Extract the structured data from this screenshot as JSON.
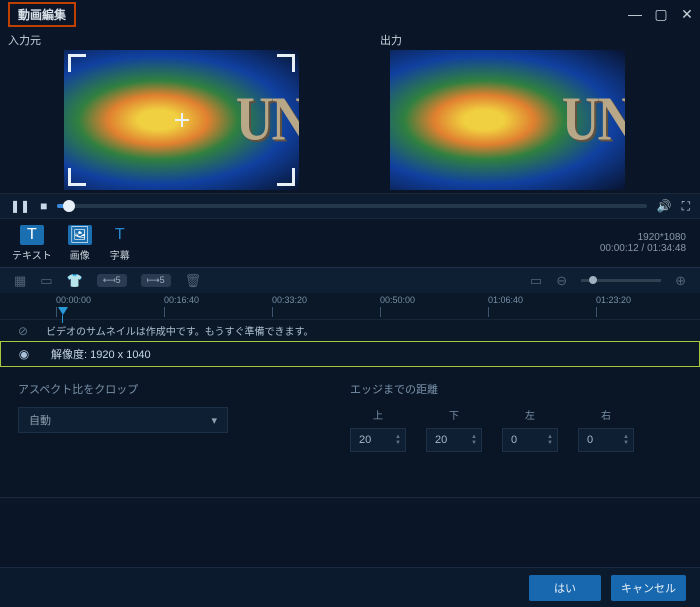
{
  "title": "動画編集",
  "preview": {
    "input_label": "入力元",
    "output_label": "出力"
  },
  "info": {
    "resolution": "1920*1080",
    "time": "00:00:12 / 01:34:48"
  },
  "tabs": {
    "text": "テキスト",
    "image": "画像",
    "subtitle": "字幕"
  },
  "timeline": {
    "btn_back5": "⟻5",
    "btn_fwd5": "⟼5",
    "ticks": [
      "00:00:00",
      "00:16:40",
      "00:33:20",
      "00:50:00",
      "01:06:40",
      "01:23:20"
    ],
    "thumb_msg": "ビデオのサムネイルは作成中です。もうすぐ準備できます。",
    "res_text": "解像度: 1920 x 1040"
  },
  "settings": {
    "aspect_label": "アスペクト比をクロップ",
    "aspect_value": "自動",
    "edge_label": "エッジまでの距離",
    "edges": {
      "top_l": "上",
      "bottom_l": "下",
      "left_l": "左",
      "right_l": "右",
      "top": "20",
      "bottom": "20",
      "left": "0",
      "right": "0"
    }
  },
  "footer": {
    "ok": "はい",
    "cancel": "キャンセル"
  }
}
